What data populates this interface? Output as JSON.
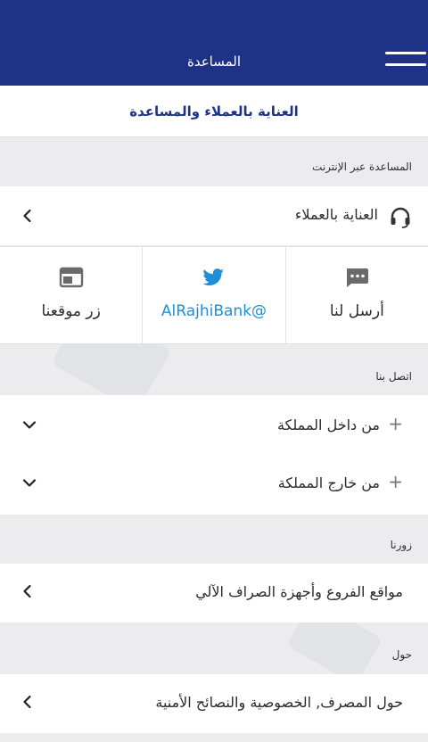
{
  "header": {
    "title": "المساعدة"
  },
  "subheader": {
    "title": "العناية بالعملاء والمساعدة"
  },
  "online_help": {
    "section_label": "المساعدة عبر الإنترنت",
    "customer_care_label": "العناية بالعملاء"
  },
  "tiles": {
    "send_label": "أرسل لنا",
    "twitter_label": "AlRajhiBank@",
    "website_label": "زر موقعنا"
  },
  "contact": {
    "section_label": "اتصل بنا",
    "inside_label": "من داخل المملكة",
    "outside_label": "من خارج المملكة"
  },
  "visit": {
    "section_label": "زورنا",
    "branches_label": "مواقع الفروع وأجهزة الصراف الآلي"
  },
  "about": {
    "section_label": "حول",
    "about_label": "حول المصرف, الخصوصية والنصائح الأمنية"
  },
  "colors": {
    "header_bg": "#1e3386",
    "accent": "#1e3386",
    "twitter": "#1e8fd6"
  }
}
